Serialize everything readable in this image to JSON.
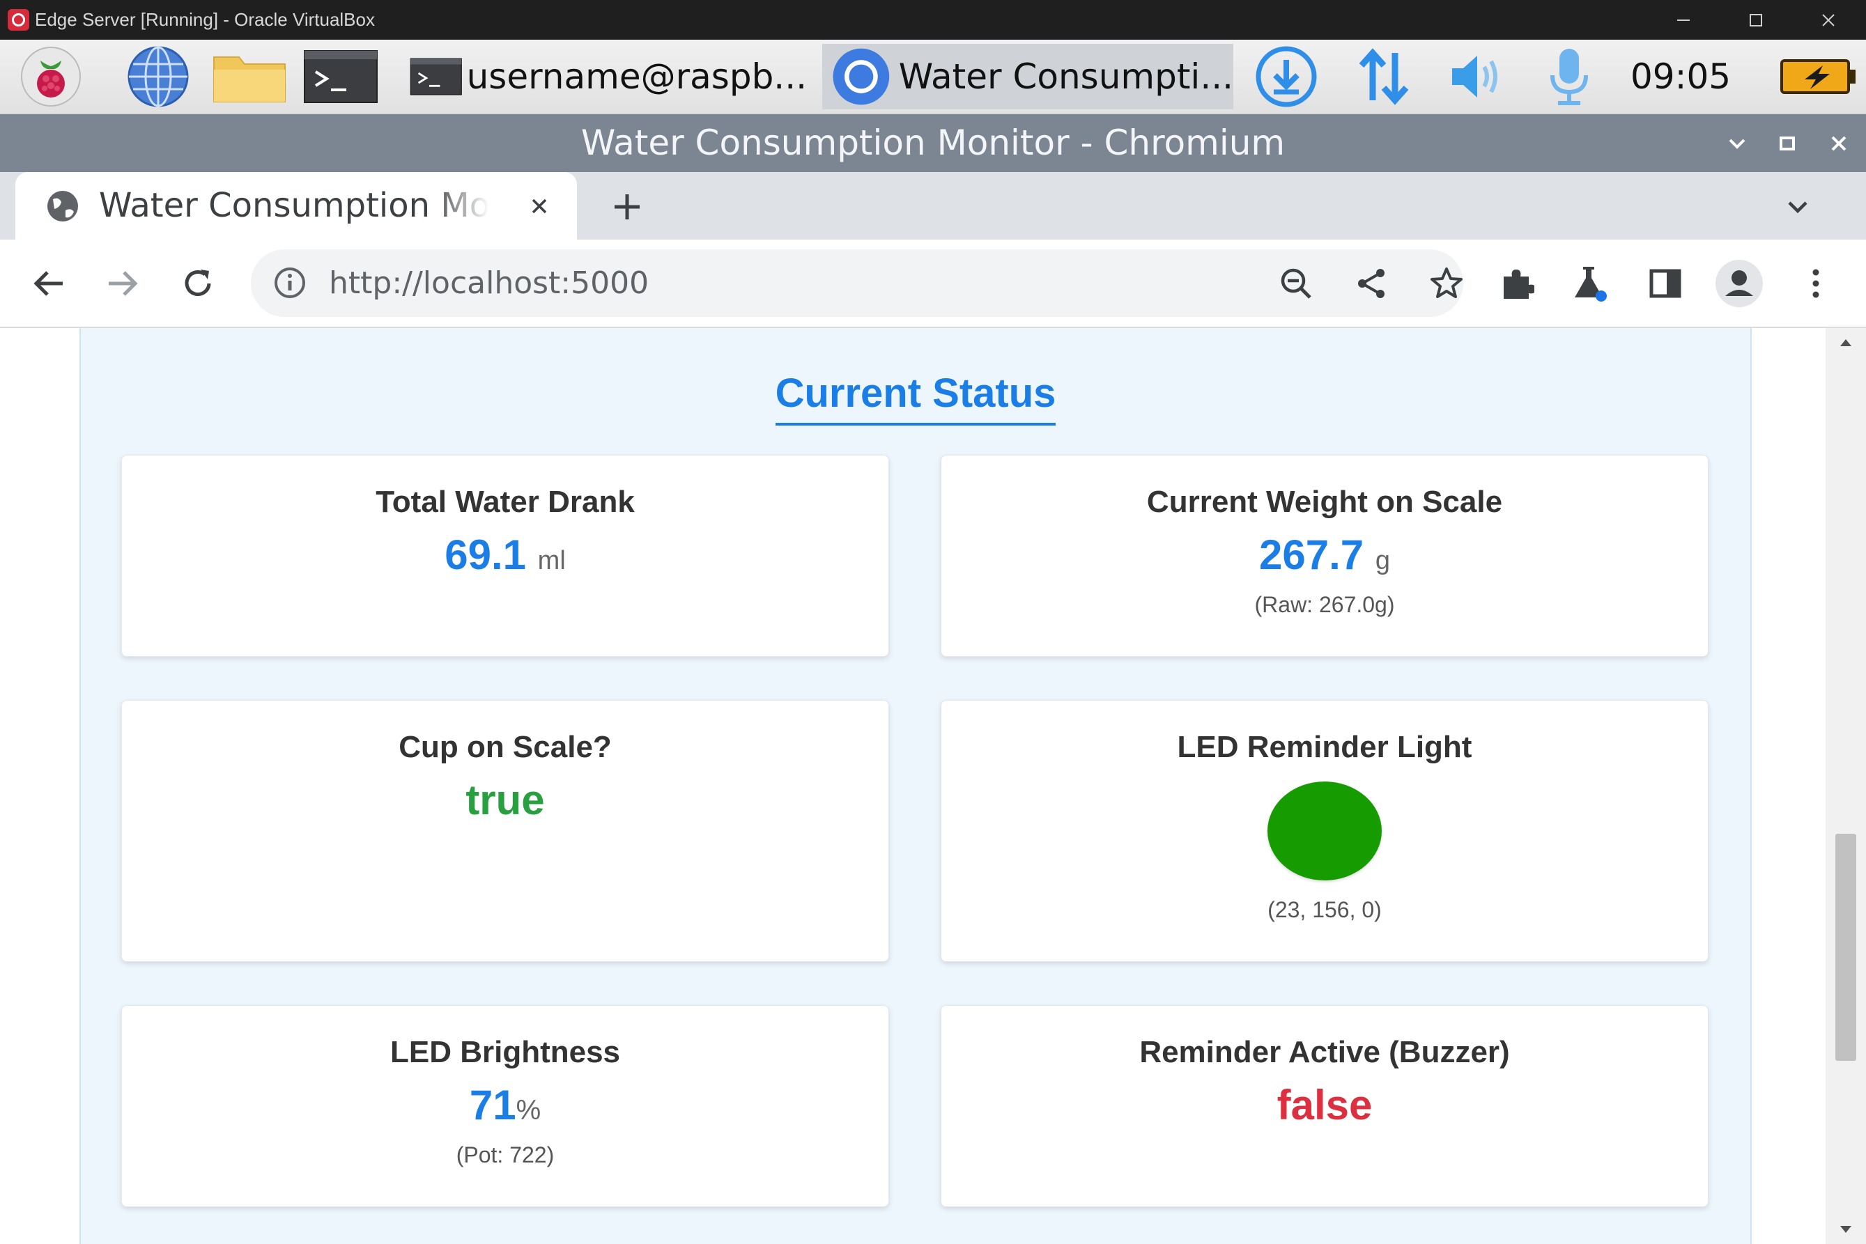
{
  "host_window": {
    "title": "Edge Server [Running] - Oracle VirtualBox"
  },
  "taskbar": {
    "terminal_task_label": "username@raspb...",
    "chromium_task_label": "Water Consumpti...",
    "clock": "09:05"
  },
  "chromium": {
    "window_title": "Water Consumption Monitor - Chromium",
    "tab_title": "Water Consumption Monitor",
    "url": "http://localhost:5000"
  },
  "page": {
    "section_title": "Current Status",
    "cards": {
      "total_water": {
        "label": "Total Water Drank",
        "value": "69.1",
        "unit": "ml"
      },
      "current_weight": {
        "label": "Current Weight on Scale",
        "value": "267.7",
        "unit": "g",
        "raw": "(Raw: 267.0g)"
      },
      "cup_on_scale": {
        "label": "Cup on Scale?",
        "value": "true"
      },
      "led_light": {
        "label": "LED Reminder Light",
        "rgb_text": "(23, 156, 0)",
        "color": "#179c00"
      },
      "led_brightness": {
        "label": "LED Brightness",
        "value": "71",
        "unit": "%",
        "pot": "(Pot: 722)"
      },
      "reminder_active": {
        "label": "Reminder Active (Buzzer)",
        "value": "false"
      }
    }
  },
  "colors": {
    "accent_blue": "#1a7ee6",
    "true_green": "#28a040",
    "false_red": "#dc3040"
  }
}
